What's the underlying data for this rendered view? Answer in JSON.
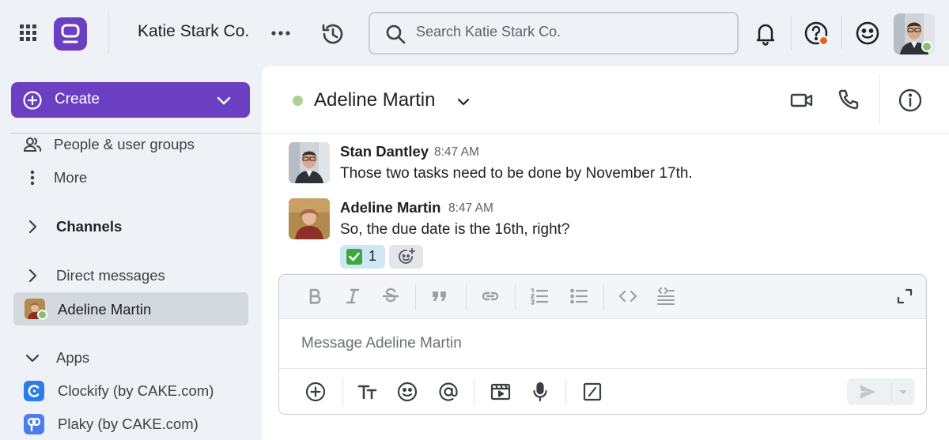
{
  "topbar": {
    "workspace_name": "Katie Stark Co.",
    "search_placeholder": "Search Katie Stark Co.",
    "icons": [
      "apps-grid-icon",
      "logo-icon",
      "more-horizontal-icon",
      "history-icon",
      "search-icon",
      "bell-icon",
      "help-icon",
      "smiley-icon",
      "user-avatar"
    ],
    "brand_color": "#6a3fc2",
    "help_badge_color": "#e8632b",
    "online_color": "#7cc36c"
  },
  "sidebar": {
    "create_label": "Create",
    "items": [
      {
        "label": "People & user groups",
        "icon": "people-icon"
      },
      {
        "label": "More",
        "icon": "more-vertical-icon"
      },
      {
        "label": "Channels",
        "icon": "chevron-right-icon"
      },
      {
        "label": "Direct messages",
        "icon": "chevron-right-icon"
      },
      {
        "label": "Adeline Martin",
        "icon": "avatar"
      },
      {
        "label": "Apps",
        "icon": "chevron-down-icon"
      },
      {
        "label": "Clockify (by CAKE.com)",
        "icon": "clockify-icon"
      },
      {
        "label": "Plaky (by CAKE.com)",
        "icon": "plaky-icon"
      }
    ]
  },
  "channel": {
    "title": "Adeline Martin",
    "icons": [
      "video-call-icon",
      "phone-icon",
      "info-icon"
    ]
  },
  "messages": [
    {
      "author": "Stan Dantley",
      "time": "8:47 AM",
      "text": "Those two tasks need to be done by November 17th."
    },
    {
      "author": "Adeline Martin",
      "time": "8:47 AM",
      "text": "So, the due date is the 16th, right?"
    }
  ],
  "reaction": {
    "emoji": "white-check-mark",
    "count": "1"
  },
  "composer": {
    "placeholder": "Message Adeline Martin",
    "format_icons": [
      "bold-icon",
      "italic-icon",
      "strikethrough-icon",
      "quote-icon",
      "link-icon",
      "numbered-list-icon",
      "bullet-list-icon",
      "code-icon",
      "code-block-icon",
      "expand-icon"
    ],
    "action_icons": [
      "add-icon",
      "text-format-icon",
      "emoji-icon",
      "mention-icon",
      "video-clip-icon",
      "microphone-icon",
      "slash-command-icon",
      "send-icon",
      "send-options-icon"
    ]
  }
}
